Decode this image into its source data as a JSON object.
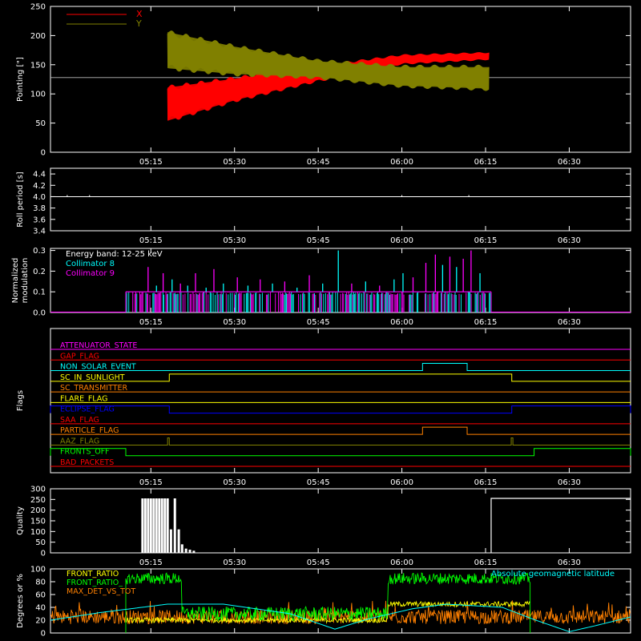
{
  "background": "#000000",
  "time_axis": {
    "ticks": [
      "05:15",
      "05:30",
      "05:45",
      "06:00",
      "06:15",
      "06:30"
    ],
    "tick_minutes": [
      315,
      330,
      345,
      360,
      375,
      390
    ],
    "range_minutes": [
      297,
      401
    ]
  },
  "chart_data": [
    {
      "id": "pointing",
      "type": "area",
      "ylabel": "Pointing [\"]",
      "ylim": [
        0,
        250
      ],
      "yticks": [
        "0",
        "50",
        "100",
        "150",
        "200",
        "250"
      ],
      "ytick_values": [
        0,
        50,
        100,
        150,
        200,
        250
      ],
      "reference_line": 128,
      "legend": [
        {
          "name": "X",
          "color": "#ff0000"
        },
        {
          "name": "Y",
          "color": "#808000"
        }
      ],
      "series": [
        {
          "name": "X",
          "color": "#ff0000",
          "start": 318.0,
          "end": 375.6,
          "upper": [
            [
              318,
              115
            ],
            [
              330,
              130
            ],
            [
              345,
              150
            ],
            [
              360,
              168
            ],
            [
              375.6,
              172
            ]
          ],
          "lower": [
            [
              318,
              50
            ],
            [
              330,
              85
            ],
            [
              345,
              120
            ],
            [
              360,
              150
            ],
            [
              375.6,
              158
            ]
          ]
        },
        {
          "name": "Y",
          "color": "#808000",
          "start": 318.0,
          "end": 375.6,
          "upper": [
            [
              318,
              210
            ],
            [
              330,
              185
            ],
            [
              345,
              160
            ],
            [
              360,
              150
            ],
            [
              375.6,
              150
            ]
          ],
          "lower": [
            [
              318,
              140
            ],
            [
              330,
              130
            ],
            [
              345,
              125
            ],
            [
              360,
              110
            ],
            [
              375.6,
              105
            ]
          ]
        }
      ]
    },
    {
      "id": "roll",
      "type": "line",
      "ylabel": "Roll period [s]",
      "ylim": [
        3.4,
        4.5
      ],
      "yticks": [
        "3.4",
        "3.6",
        "3.8",
        "4.0",
        "4.2",
        "4.4"
      ],
      "ytick_values": [
        3.4,
        3.6,
        3.8,
        4.0,
        4.2,
        4.4
      ],
      "value": 4.0,
      "color": "#ffffff"
    },
    {
      "id": "modulation",
      "type": "line",
      "ylabel": [
        "Normalized",
        "modulation"
      ],
      "ylim": [
        0,
        0.31
      ],
      "yticks": [
        "0.0",
        "0.1",
        "0.2",
        "0.3"
      ],
      "ytick_values": [
        0.0,
        0.1,
        0.2,
        0.3
      ],
      "annotation": "Energy band: 12-25 keV",
      "legend": [
        {
          "name": "Collimator 8",
          "color": "#00ffff"
        },
        {
          "name": "Collimator 9",
          "color": "#ff00ff"
        }
      ],
      "active_range": [
        310.5,
        376.0
      ],
      "baseline_level": 0.1,
      "spikes": [
        {
          "t": 314.5,
          "v": 0.22,
          "c": "c9"
        },
        {
          "t": 316.0,
          "v": 0.13,
          "c": "c8"
        },
        {
          "t": 317.2,
          "v": 0.19,
          "c": "c9"
        },
        {
          "t": 318.8,
          "v": 0.16,
          "c": "c8"
        },
        {
          "t": 320.3,
          "v": 0.14,
          "c": "c9"
        },
        {
          "t": 321.6,
          "v": 0.13,
          "c": "c8"
        },
        {
          "t": 323.0,
          "v": 0.19,
          "c": "c9"
        },
        {
          "t": 324.9,
          "v": 0.12,
          "c": "c8"
        },
        {
          "t": 326.3,
          "v": 0.21,
          "c": "c9"
        },
        {
          "t": 328.0,
          "v": 0.14,
          "c": "c8"
        },
        {
          "t": 330.5,
          "v": 0.17,
          "c": "c9"
        },
        {
          "t": 332.4,
          "v": 0.13,
          "c": "c8"
        },
        {
          "t": 334.6,
          "v": 0.16,
          "c": "c9"
        },
        {
          "t": 336.8,
          "v": 0.14,
          "c": "c8"
        },
        {
          "t": 339.0,
          "v": 0.15,
          "c": "c9"
        },
        {
          "t": 341.2,
          "v": 0.12,
          "c": "c8"
        },
        {
          "t": 343.4,
          "v": 0.18,
          "c": "c9"
        },
        {
          "t": 345.8,
          "v": 0.14,
          "c": "c8"
        },
        {
          "t": 348.6,
          "v": 0.3,
          "c": "c8"
        },
        {
          "t": 351.0,
          "v": 0.14,
          "c": "c9"
        },
        {
          "t": 353.5,
          "v": 0.15,
          "c": "c8"
        },
        {
          "t": 356.0,
          "v": 0.13,
          "c": "c9"
        },
        {
          "t": 358.6,
          "v": 0.16,
          "c": "c8"
        },
        {
          "t": 360.2,
          "v": 0.19,
          "c": "c8"
        },
        {
          "t": 362.0,
          "v": 0.17,
          "c": "c9"
        },
        {
          "t": 364.3,
          "v": 0.24,
          "c": "c9"
        },
        {
          "t": 366.0,
          "v": 0.28,
          "c": "c9"
        },
        {
          "t": 367.3,
          "v": 0.23,
          "c": "c8"
        },
        {
          "t": 368.6,
          "v": 0.27,
          "c": "c9"
        },
        {
          "t": 369.8,
          "v": 0.22,
          "c": "c8"
        },
        {
          "t": 371.0,
          "v": 0.26,
          "c": "c9"
        },
        {
          "t": 372.4,
          "v": 0.3,
          "c": "c9"
        },
        {
          "t": 374.0,
          "v": 0.19,
          "c": "c8"
        }
      ]
    },
    {
      "id": "flags",
      "type": "line",
      "ylabel": "Flags",
      "flags": [
        {
          "name": "ATTENUATOR_STATE",
          "color": "#ff00ff",
          "pulses": []
        },
        {
          "name": "GAP_FLAG",
          "color": "#ff0000",
          "pulses": []
        },
        {
          "name": "NON_SOLAR_EVENT",
          "color": "#00ffff",
          "pulses": [
            [
              363.7,
              371.7
            ]
          ]
        },
        {
          "name": "SC_IN_SUNLIGHT",
          "color": "#ffff00",
          "pulses": [
            [
              318.3,
              379.7
            ]
          ]
        },
        {
          "name": "SC_TRANSMITTER",
          "color": "#ff8000",
          "pulses": []
        },
        {
          "name": "FLARE_FLAG",
          "color": "#ffff00",
          "pulses": []
        },
        {
          "name": "ECLIPSE_FLAG",
          "color": "#0000ff",
          "pulses": [
            [
              297,
              318.3
            ],
            [
              379.7,
              401
            ]
          ]
        },
        {
          "name": "SAA_FLAG",
          "color": "#ff0000",
          "pulses": []
        },
        {
          "name": "PARTICLE_FLAG",
          "color": "#ff8000",
          "pulses": [
            [
              363.7,
              371.7
            ]
          ]
        },
        {
          "name": "AAZ_FLAG",
          "color": "#808000",
          "pulses": [
            [
              318.0,
              318.3
            ],
            [
              379.6,
              379.9
            ]
          ]
        },
        {
          "name": "FRONTS_OFF",
          "color": "#00ff00",
          "pulses": [
            [
              297,
              310.5
            ],
            [
              383.7,
              401
            ]
          ]
        },
        {
          "name": "BAD_PACKETS",
          "color": "#ff0000",
          "pulses": []
        }
      ]
    },
    {
      "id": "quality",
      "type": "line",
      "ylabel": "Quality",
      "ylim": [
        0,
        300
      ],
      "yticks": [
        "0",
        "50",
        "100",
        "150",
        "200",
        "250",
        "300"
      ],
      "ytick_values": [
        0,
        50,
        100,
        150,
        200,
        250,
        300
      ],
      "color": "#ffffff",
      "bursts": [
        [
          313.5,
          255
        ],
        [
          314.0,
          255
        ],
        [
          314.5,
          255
        ],
        [
          315.0,
          255
        ],
        [
          315.5,
          255
        ],
        [
          316.0,
          255
        ],
        [
          316.5,
          255
        ],
        [
          317.0,
          255
        ],
        [
          317.5,
          255
        ],
        [
          318.0,
          255
        ],
        [
          318.6,
          110
        ],
        [
          319.3,
          255
        ],
        [
          320.0,
          110
        ],
        [
          320.6,
          40
        ],
        [
          321.3,
          20
        ],
        [
          322.0,
          15
        ],
        [
          322.7,
          10
        ]
      ],
      "high_from": 376.0,
      "high_value": 255
    },
    {
      "id": "ratio",
      "type": "line",
      "ylabel": "Degrees or %",
      "ylim": [
        0,
        100
      ],
      "yticks": [
        "0",
        "20",
        "40",
        "60",
        "80",
        "100"
      ],
      "ytick_values": [
        0,
        20,
        40,
        60,
        80,
        100
      ],
      "legend": [
        {
          "name": "FRONT_RATIO",
          "color": "#ffff00"
        },
        {
          "name": "FRONT_RATIO_",
          "color": "#00ff00"
        },
        {
          "name": "MAX_DET_VS_TOT",
          "color": "#ff8000"
        }
      ],
      "annotation_right": "Absolute geomagnetic latitude",
      "annotation_right_color": "#00ffff",
      "green_high": [
        [
          310.5,
          320.5
        ],
        [
          357.5,
          383.0
        ]
      ],
      "green_high_level": 85,
      "green_low_level": 30,
      "yellow_bump": [
        [
          357.5,
          383.0
        ]
      ],
      "yellow_level_high": 45,
      "yellow_level_low": 20,
      "orange_level": 25,
      "latitude": [
        [
          297,
          20
        ],
        [
          306,
          32
        ],
        [
          318,
          45
        ],
        [
          328,
          45
        ],
        [
          340,
          30
        ],
        [
          348,
          6
        ],
        [
          354,
          22
        ],
        [
          362,
          38
        ],
        [
          368,
          45
        ],
        [
          378,
          40
        ],
        [
          384,
          20
        ],
        [
          390,
          2
        ],
        [
          395,
          12
        ],
        [
          401,
          25
        ]
      ]
    }
  ]
}
